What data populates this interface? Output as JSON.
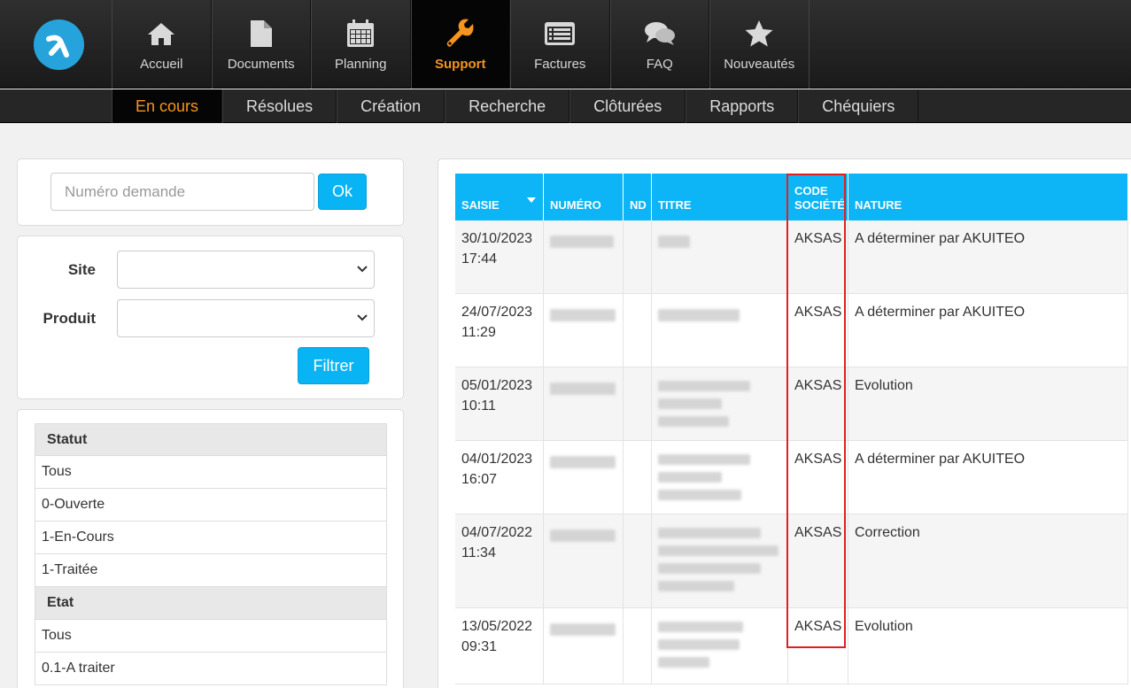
{
  "nav": {
    "items": [
      {
        "label": "Accueil",
        "icon": "home-icon"
      },
      {
        "label": "Documents",
        "icon": "document-icon"
      },
      {
        "label": "Planning",
        "icon": "calendar-icon"
      },
      {
        "label": "Support",
        "icon": "wrench-icon",
        "active": true
      },
      {
        "label": "Factures",
        "icon": "invoice-icon"
      },
      {
        "label": "FAQ",
        "icon": "chat-icon"
      },
      {
        "label": "Nouveautés",
        "icon": "star-icon"
      }
    ]
  },
  "subnav": {
    "items": [
      "En cours",
      "Résolues",
      "Création",
      "Recherche",
      "Clôturées",
      "Rapports",
      "Chéquiers"
    ],
    "active": "En cours"
  },
  "search": {
    "placeholder": "Numéro demande",
    "ok_label": "Ok"
  },
  "filter": {
    "site_label": "Site",
    "product_label": "Produit",
    "button_label": "Filtrer"
  },
  "status_list": {
    "statut_header": "Statut",
    "statut_items": [
      "Tous",
      "0-Ouverte",
      "1-En-Cours",
      "1-Traitée"
    ],
    "etat_header": "Etat",
    "etat_items": [
      "Tous",
      "0.1-A traiter"
    ]
  },
  "table": {
    "headers": [
      "SAISIE",
      "NUMÉRO",
      "ND",
      "TITRE",
      "CODE SOCIÉTÉ",
      "NATURE"
    ],
    "rows": [
      {
        "date": "30/10/2023",
        "time": "17:44",
        "code": "AKSAS",
        "nature": "A déterminer par AKUITEO"
      },
      {
        "date": "24/07/2023",
        "time": "11:29",
        "code": "AKSAS",
        "nature": "A déterminer par AKUITEO"
      },
      {
        "date": "05/01/2023",
        "time": "10:11",
        "code": "AKSAS",
        "nature": "Evolution"
      },
      {
        "date": "04/01/2023",
        "time": "16:07",
        "code": "AKSAS",
        "nature": "A déterminer par AKUITEO"
      },
      {
        "date": "04/07/2022",
        "time": "11:34",
        "code": "AKSAS",
        "nature": "Correction"
      },
      {
        "date": "13/05/2022",
        "time": "09:31",
        "code": "AKSAS",
        "nature": "Evolution"
      }
    ]
  },
  "colors": {
    "accent_orange": "#f7941d",
    "header_blue": "#0db5f6",
    "button_blue": "#08b4f4",
    "highlight_red": "#e02020"
  }
}
